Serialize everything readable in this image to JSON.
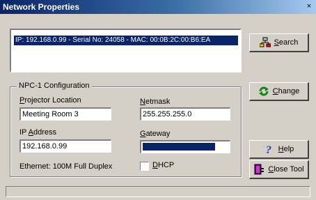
{
  "window": {
    "title": "Network Properties",
    "close_glyph": "×"
  },
  "device_list": {
    "items": [
      {
        "text": "IP:   192.168.0.99  -  Serial No: 24058  -  MAC: 00:0B:2C:00:B6:EA",
        "selected": true
      }
    ]
  },
  "config": {
    "group_title": "NPC-1 Configuration",
    "projector_location": {
      "label_ul": "P",
      "label_rest": "rojector Location",
      "value": "Meeting Room 3"
    },
    "netmask": {
      "label_ul": "N",
      "label_rest": "etmask",
      "value": "255.255.255.0"
    },
    "ip_address": {
      "label_pre": "IP ",
      "label_ul": "A",
      "label_rest": "ddress",
      "value": "192.168.0.99"
    },
    "gateway": {
      "label_ul": "G",
      "label_rest": "ateway",
      "value_fill_fraction": 0.83,
      "fill_color": "#0a246a"
    },
    "ethernet_status": "Ethernet: 100M Full Duplex",
    "dhcp": {
      "label_ul": "D",
      "label_rest": "HCP",
      "checked": false
    }
  },
  "buttons": {
    "search": {
      "ul": "S",
      "rest": "earch",
      "icon": "network-search-icon"
    },
    "change": {
      "ul": "C",
      "rest": "hange",
      "icon": "green-refresh-icon"
    },
    "help": {
      "ul": "H",
      "rest": "elp",
      "icon": "question-icon"
    },
    "close_tool": {
      "ul": "C",
      "rest": "lose Tool",
      "icon": "exit-door-icon"
    }
  },
  "colors": {
    "title_bar": "#0a246a",
    "selection": "#0a246a",
    "face": "#d4d0c8"
  }
}
